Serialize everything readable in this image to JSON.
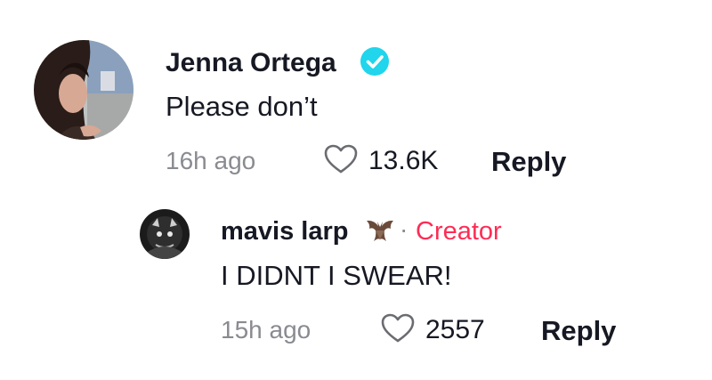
{
  "comments": [
    {
      "username": "Jenna Ortega",
      "verified": true,
      "text": "Please don’t",
      "time": "16h ago",
      "likes": "13.6K",
      "reply_label": "Reply",
      "avatar_icon": "profile-photo"
    }
  ],
  "reply": {
    "username": "mavis larp",
    "emoji_icon": "bat-icon",
    "separator": "·",
    "badge": "Creator",
    "text": "I DIDNT I SWEAR!",
    "time": "15h ago",
    "likes": "2557",
    "reply_label": "Reply",
    "avatar_icon": "profile-photo"
  },
  "colors": {
    "verified_badge": "#20d5ec",
    "creator_badge": "#fe2c55",
    "muted_text": "#8a8b91",
    "primary_text": "#161823"
  }
}
